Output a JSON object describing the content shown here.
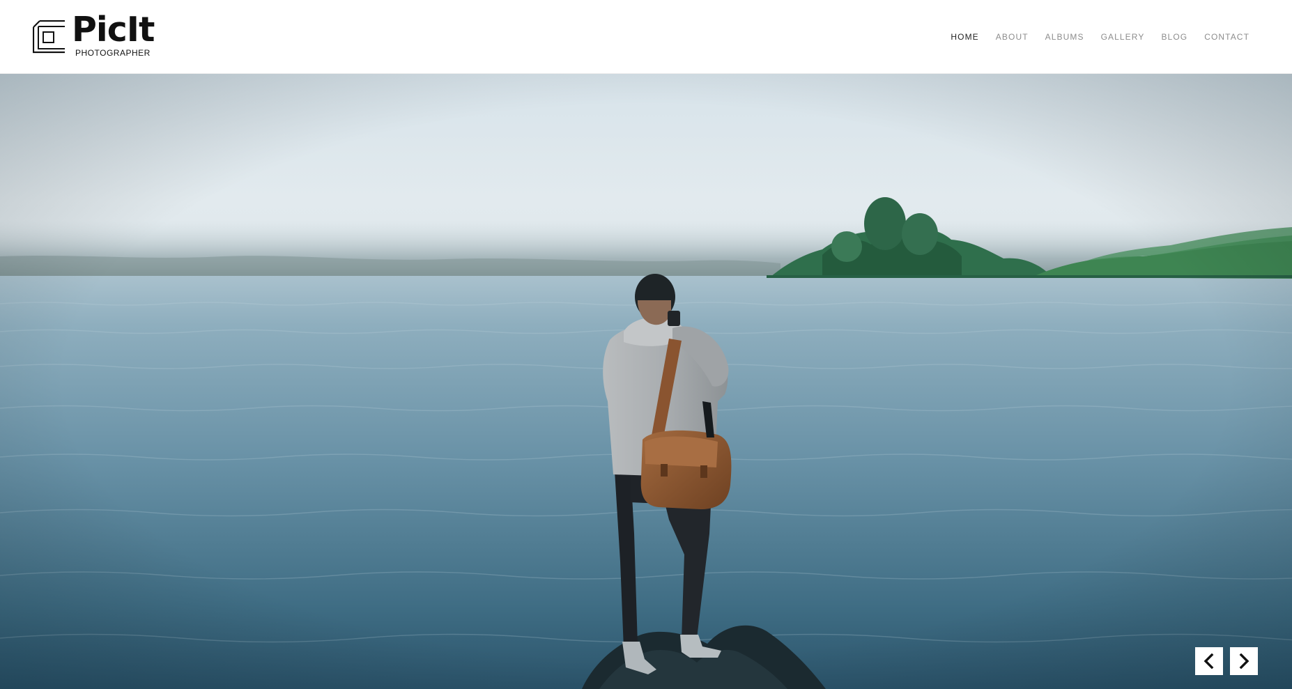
{
  "brand": {
    "name": "PicIt",
    "tagline": "PHOTOGRAPHER",
    "logo_icon": "nested-square-frame-icon"
  },
  "nav": {
    "items": [
      {
        "label": "HOME",
        "active": true
      },
      {
        "label": "ABOUT",
        "active": false
      },
      {
        "label": "ALBUMS",
        "active": false
      },
      {
        "label": "GALLERY",
        "active": false
      },
      {
        "label": "BLOG",
        "active": false
      },
      {
        "label": "CONTACT",
        "active": false
      }
    ]
  },
  "hero": {
    "image_subject": "photographer with leather satchel standing on a rock at a misty lake",
    "controls": {
      "prev_icon": "chevron-left-icon",
      "next_icon": "chevron-right-icon"
    }
  },
  "colors": {
    "header_bg": "#ffffff",
    "nav_text": "#8c8c8c",
    "nav_active": "#222222",
    "sky": "#dfe8ee",
    "water": "#4f7d93",
    "button_bg": "#ffffff"
  }
}
